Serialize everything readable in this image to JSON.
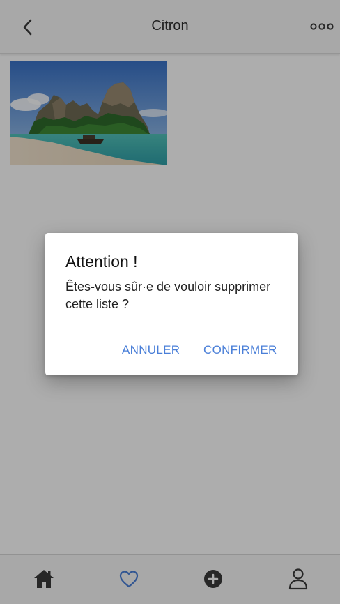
{
  "header": {
    "title": "Citron"
  },
  "dialog": {
    "title": "Attention !",
    "message": "Êtes-vous sûr·e de vouloir supprimer cette liste ?",
    "cancel_label": "ANNULER",
    "confirm_label": "CONFIRMER"
  },
  "icons": {
    "back": "chevron-left-icon",
    "more": "more-horizontal-icon",
    "home": "home-icon",
    "favorites": "heart-icon",
    "add": "plus-circle-icon",
    "profile": "user-icon"
  },
  "colors": {
    "accent": "#4a7fd8",
    "icon": "#3a3a3a",
    "overlay": "rgba(0,0,0,0.32)"
  }
}
